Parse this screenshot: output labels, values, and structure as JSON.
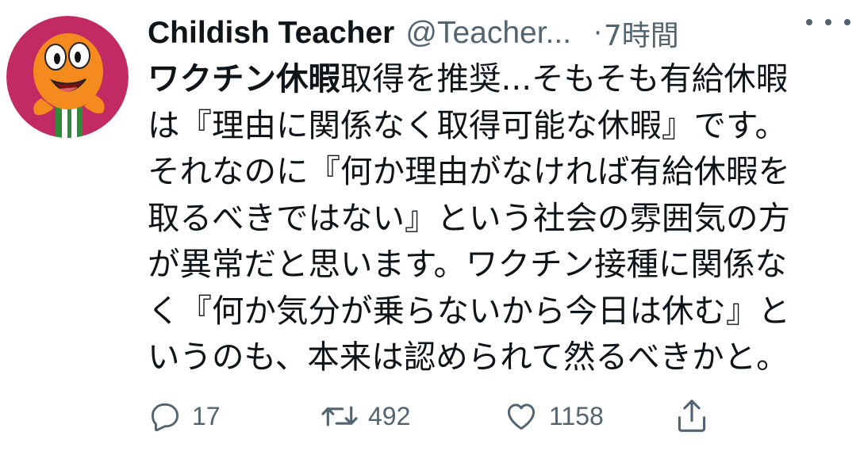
{
  "tweet": {
    "author": {
      "display_name": "Childish Teacher",
      "handle": "@Teacher..."
    },
    "separator": "·",
    "time": "7時間",
    "body": {
      "bold_lead": "ワクチン休暇",
      "line1_rest": "取得を推奨...そもそも有給休暇",
      "lines": [
        "は『理由に関係なく取得可能な休暇』です。",
        "それなのに『何か理由がなければ有給休暇を",
        "取るべきではない』という社会の雰囲気の方",
        "が異常だと思います。ワクチン接種に関係な",
        "く『何か気分が乗らないから今日は休む』と",
        "いうのも、本来は認められて然るべきかと。"
      ]
    },
    "actions": {
      "reply": {
        "icon": "reply-icon",
        "count": "17"
      },
      "retweet": {
        "icon": "retweet-icon",
        "count": "492"
      },
      "like": {
        "icon": "heart-icon",
        "count": "1158"
      },
      "share": {
        "icon": "share-icon"
      }
    }
  },
  "colors": {
    "text_primary": "#0f1419",
    "text_secondary": "#536471",
    "avatar_background": "#c22a63",
    "avatar_character": "#f58a1f"
  }
}
